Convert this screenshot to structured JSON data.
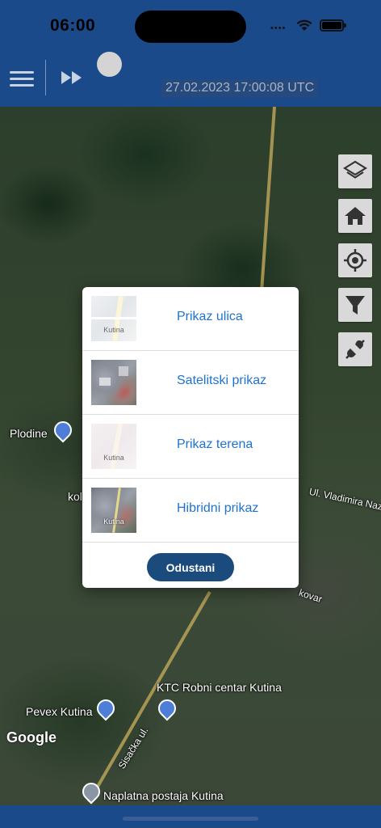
{
  "status_bar": {
    "time": "06:00",
    "signal": "••••"
  },
  "header": {
    "timestamp": "27.02.2023 17:00:08 UTC"
  },
  "map": {
    "labels": {
      "plodine": "Plodine",
      "kol": "kol",
      "pevex": "Pevex Kutina",
      "ktc": "KTC Robni centar Kutina",
      "naplatna": "Naplatna postaja Kutina",
      "sisacka": "Sisačka ul.",
      "nazor": "Ul. Vladimira Nazora",
      "kovar": "kovar"
    },
    "attribution": "Google"
  },
  "map_controls": [
    "layers-icon",
    "home-icon",
    "locate-icon",
    "filter-icon",
    "plug-icon"
  ],
  "layer_dialog": {
    "options": [
      {
        "label": "Prikaz ulica",
        "thumb_text": "Kutina"
      },
      {
        "label": "Satelitski prikaz",
        "thumb_text": ""
      },
      {
        "label": "Prikaz terena",
        "thumb_text": "Kutina"
      },
      {
        "label": "Hibridni prikaz",
        "thumb_text": "Kutina"
      }
    ],
    "cancel_label": "Odustani"
  },
  "colors": {
    "accent": "#1b4a8a",
    "link": "#1e73d2",
    "button": "#1b4a7d"
  }
}
